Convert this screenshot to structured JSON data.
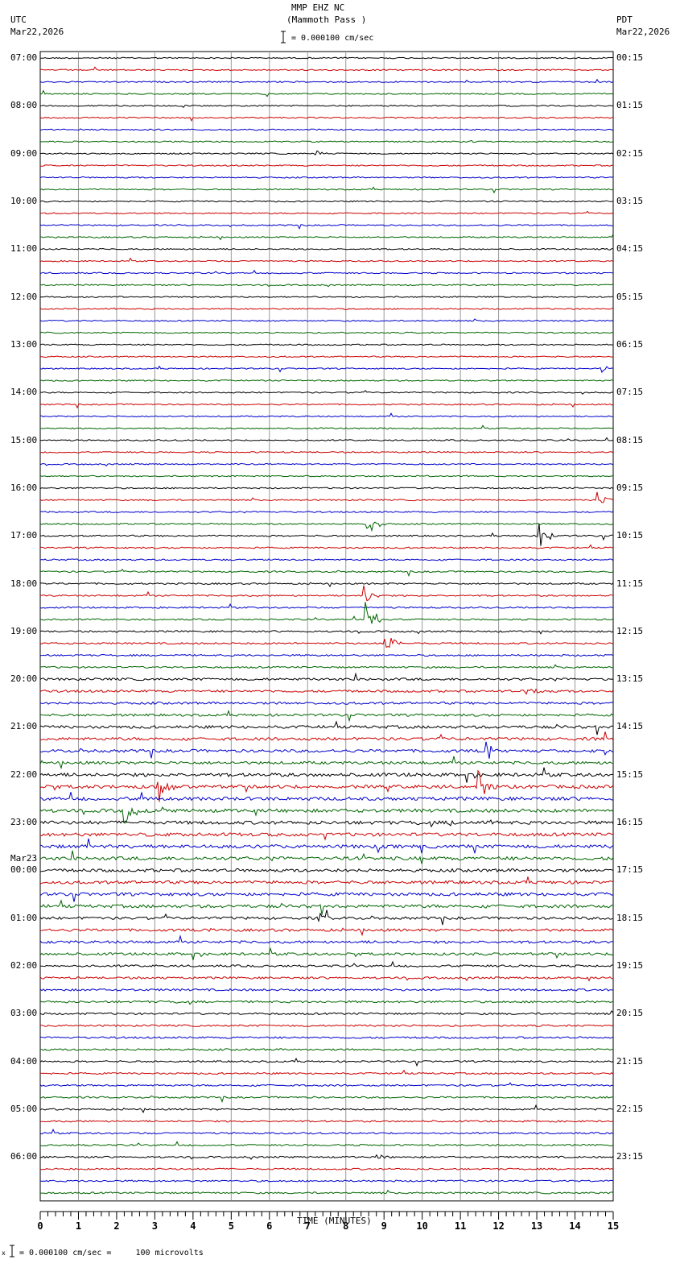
{
  "header": {
    "title": "MMP EHZ NC",
    "subtitle": "(Mammoth Pass )",
    "left_tz": "UTC",
    "left_date": "Mar22,2026",
    "right_tz": "PDT",
    "right_date": "Mar22,2026",
    "scale_text": "= 0.000100 cm/sec"
  },
  "footer": {
    "scale_text": "= 0.000100 cm/sec =     100 microvolts",
    "prefix": "x"
  },
  "chart_data": {
    "type": "line",
    "title": "MMP EHZ NC (Mammoth Pass )",
    "xlabel": "TIME (MINUTES)",
    "xlim": [
      0,
      15
    ],
    "x_ticks": [
      "0",
      "1",
      "2",
      "3",
      "4",
      "5",
      "6",
      "7",
      "8",
      "9",
      "10",
      "11",
      "12",
      "13",
      "14",
      "15"
    ],
    "traces_per_hour": 4,
    "trace_colors": [
      "#000000",
      "#cc0000",
      "#0000cc",
      "#006600"
    ],
    "left_labels": [
      "07:00",
      "08:00",
      "09:00",
      "10:00",
      "11:00",
      "12:00",
      "13:00",
      "14:00",
      "15:00",
      "16:00",
      "17:00",
      "18:00",
      "19:00",
      "20:00",
      "21:00",
      "22:00",
      "23:00",
      "00:00",
      "01:00",
      "02:00",
      "03:00",
      "04:00",
      "05:00",
      "06:00"
    ],
    "date_change_label": "Mar23",
    "right_labels": [
      "00:15",
      "01:15",
      "02:15",
      "03:15",
      "04:15",
      "05:15",
      "06:15",
      "07:15",
      "08:15",
      "09:15",
      "10:15",
      "11:15",
      "12:15",
      "13:15",
      "14:15",
      "15:15",
      "16:15",
      "17:15",
      "18:15",
      "19:15",
      "20:15",
      "21:15",
      "22:15",
      "23:15"
    ],
    "noise_level_per_hour": [
      1,
      1,
      1,
      1,
      1,
      1,
      1,
      1,
      1,
      1.1,
      1.2,
      1.2,
      1.3,
      1.8,
      2.2,
      2.6,
      2.6,
      2.4,
      2,
      1.6,
      1.4,
      1.3,
      1.3,
      1.3
    ],
    "events": [
      {
        "trace": 8,
        "minute": 7.25,
        "amp": 4
      },
      {
        "trace": 26,
        "minute": 14.65,
        "amp": 6
      },
      {
        "trace": 37,
        "minute": 14.6,
        "amp": 12
      },
      {
        "trace": 39,
        "minute": 8.6,
        "amp": 16
      },
      {
        "trace": 40,
        "minute": 13.1,
        "amp": 16
      },
      {
        "trace": 45,
        "minute": 8.5,
        "amp": 14
      },
      {
        "trace": 47,
        "minute": 8.55,
        "amp": 30
      },
      {
        "trace": 49,
        "minute": 9.05,
        "amp": 16
      },
      {
        "trace": 53,
        "minute": 12.7,
        "amp": 12
      },
      {
        "trace": 58,
        "minute": 11.7,
        "amp": 14
      },
      {
        "trace": 61,
        "minute": 3.1,
        "amp": 28
      },
      {
        "trace": 61,
        "minute": 11.5,
        "amp": 22
      },
      {
        "trace": 63,
        "minute": 2.2,
        "amp": 20
      },
      {
        "trace": 72,
        "minute": 7.3,
        "amp": 8
      },
      {
        "trace": 92,
        "minute": 8.75,
        "amp": 6
      }
    ]
  }
}
